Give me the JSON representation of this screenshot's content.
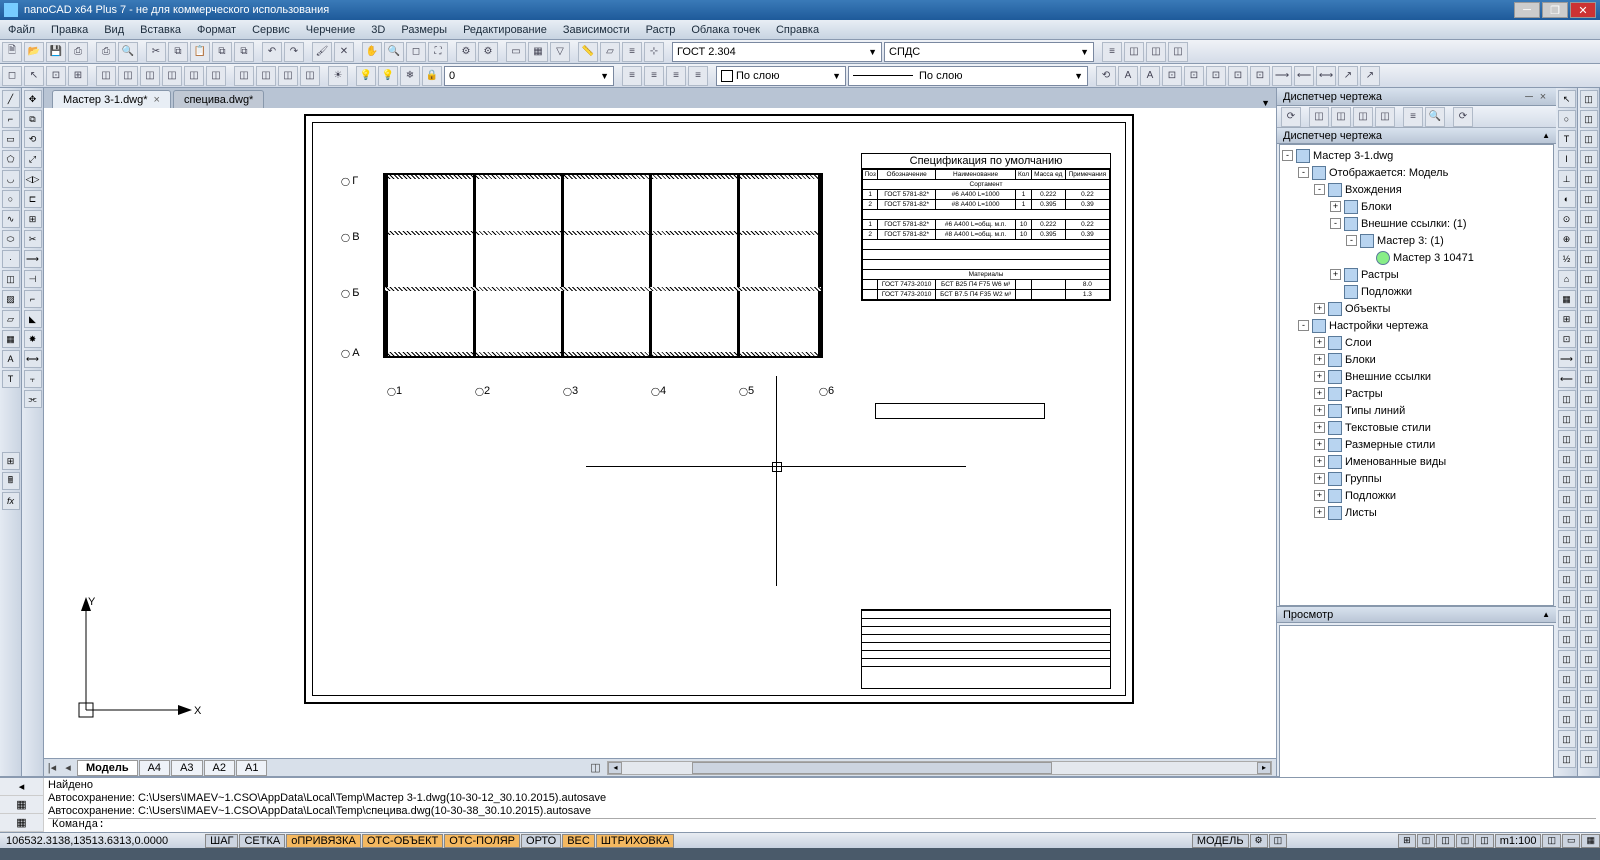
{
  "title": "nanoCAD x64 Plus 7 - не для коммерческого использования",
  "menu": [
    "Файл",
    "Правка",
    "Вид",
    "Вставка",
    "Формат",
    "Сервис",
    "Черчение",
    "3D",
    "Размеры",
    "Редактирование",
    "Зависимости",
    "Растр",
    "Облака точек",
    "Справка"
  ],
  "textStyle": "ГОСТ 2.304",
  "dimStyle": "СПДС",
  "layer": "0",
  "byLayer1": "По слою",
  "byLayer2": "По слою",
  "docTabs": [
    {
      "label": "Мастер 3-1.dwg*",
      "active": true
    },
    {
      "label": "специва.dwg*",
      "active": false
    }
  ],
  "modelTabs": {
    "active": "Модель",
    "sheets": [
      "А4",
      "А3",
      "А2",
      "А1"
    ]
  },
  "rightPanel": {
    "title": "Диспетчер чертежа",
    "section": "Диспетчер чертежа",
    "tree": {
      "root": "Мастер 3-1.dwg",
      "display": "Отображается: Модель",
      "refs": "Вхождения",
      "blocks": "Блоки",
      "xrefs": "Внешние ссылки: (1)",
      "xref1": "Мастер 3: (1)",
      "xref1item": "Мастер 3  10471",
      "rasters": "Растры",
      "underlays": "Подложки",
      "objects": "Объекты",
      "settings": "Настройки чертежа",
      "layers": "Слои",
      "blocks2": "Блоки",
      "xrefs2": "Внешние ссылки",
      "rasters2": "Растры",
      "ltypes": "Типы линий",
      "txtstyles": "Текстовые стили",
      "dimstyles": "Размерные стили",
      "views": "Именованные виды",
      "groups": "Группы",
      "underlays2": "Подложки",
      "sheets": "Листы"
    },
    "preview": "Просмотр"
  },
  "spec": {
    "title": "Спецификация по умолчанию",
    "headers": [
      "Поз",
      "Обозначение",
      "Наименование",
      "Кол",
      "Масса ед",
      "Примечания"
    ],
    "section1": "Сортамент",
    "rows1": [
      [
        "1",
        "ГОСТ 5781-82*",
        "#6   А400   L=1000",
        "1",
        "0.222",
        "0.22"
      ],
      [
        "2",
        "ГОСТ 5781-82*",
        "#8   А400   L=1000",
        "1",
        "0.395",
        "0.39"
      ]
    ],
    "rows2": [
      [
        "1",
        "ГОСТ 5781-82*",
        "#6   А400   L=общ. м.п.",
        "10",
        "0.222",
        "0.22"
      ],
      [
        "2",
        "ГОСТ 5781-82*",
        "#8   А400   L=общ. м.п.",
        "10",
        "0.395",
        "0.39"
      ]
    ],
    "section2": "Материалы",
    "rows3": [
      [
        "",
        "ГОСТ 7473-2010",
        "БСТ В25 П4 F75 W6  м³",
        "",
        "",
        "8.0"
      ],
      [
        "",
        "ГОСТ 7473-2010",
        "БСТ В7.5 П4 F35 W2  м³",
        "",
        "",
        "1.3"
      ]
    ]
  },
  "gridLetters": [
    "Г",
    "В",
    "Б",
    "А"
  ],
  "gridNums": [
    "1",
    "2",
    "3",
    "4",
    "5",
    "6"
  ],
  "ucs": {
    "y": "Y",
    "x": "X"
  },
  "cmd": {
    "found": "Найдено",
    "line1": "Автосохранение: C:\\Users\\IMAEV~1.CSO\\AppData\\Local\\Temp\\Мастер 3-1.dwg(10-30-12_30.10.2015).autosave",
    "line2": "Автосохранение: C:\\Users\\IMAEV~1.CSO\\AppData\\Local\\Temp\\специва.dwg(10-30-38_30.10.2015).autosave",
    "prompt": "Команда:"
  },
  "status": {
    "coord": "106532.3138,13513.6313,0.0000",
    "btns": [
      {
        "t": "ШАГ",
        "on": false
      },
      {
        "t": "СЕТКА",
        "on": false
      },
      {
        "t": "оПРИВЯЗКА",
        "on": true
      },
      {
        "t": "ОТС-ОБЪЕКТ",
        "on": true
      },
      {
        "t": "ОТС-ПОЛЯР",
        "on": true
      },
      {
        "t": "ОРТО",
        "on": false
      },
      {
        "t": "ВЕС",
        "on": true
      },
      {
        "t": "ШТРИХОВКА",
        "on": true
      }
    ],
    "space": "МОДЕЛЬ",
    "scale": "m1:100"
  }
}
